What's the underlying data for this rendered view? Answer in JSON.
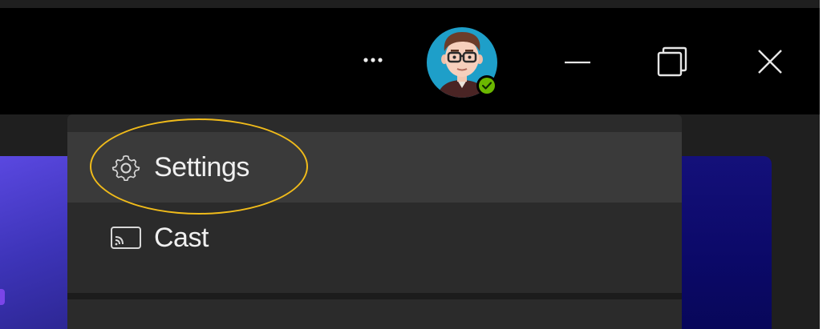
{
  "titlebar": {
    "more_icon": "ellipsis-icon",
    "avatar": {
      "status": "available",
      "status_color": "#6bb700"
    },
    "minimize_icon": "minimize-icon",
    "maximize_icon": "restore-icon",
    "close_icon": "close-icon"
  },
  "menu": {
    "items": [
      {
        "label": "Settings",
        "icon": "gear-icon"
      },
      {
        "label": "Cast",
        "icon": "cast-icon"
      }
    ]
  },
  "annotation": {
    "color": "#f0bb1a"
  },
  "colors": {
    "titlebar": "#000000",
    "menu_bg": "#2b2b2b",
    "menu_hover": "#3a3a3a",
    "accent_purple": "#4b3fd0",
    "accent_navy": "#0f0c70"
  }
}
